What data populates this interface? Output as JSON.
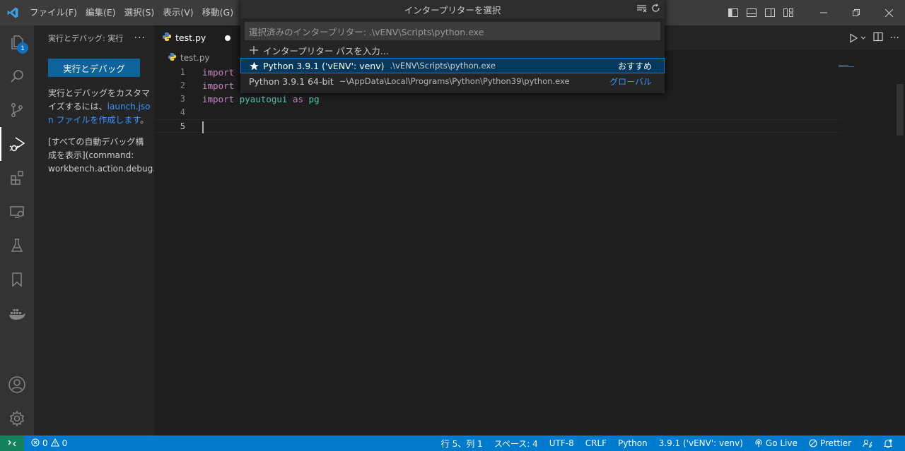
{
  "menu": [
    "ファイル(F)",
    "編集(E)",
    "選択(S)",
    "表示(V)",
    "移動(G)"
  ],
  "activity_badge": "1",
  "sidebar": {
    "header": "実行とデバッグ: 実行",
    "more": "···",
    "run_button": "実行とデバッグ",
    "text_before_link": "実行とデバッグをカスタマイズするには、",
    "link": "launch.json ファイルを作成します",
    "text_after_link": "。",
    "text2_line1": "[すべての自動デバッグ構",
    "text2_line2": "成を表示](command:",
    "text2_line3": "workbench.action.debug.s"
  },
  "editor": {
    "tab_label": "test.py",
    "breadcrumb": "test.py",
    "lines": [
      {
        "num": "1",
        "kw": "import",
        "rest": ""
      },
      {
        "num": "2",
        "kw": "import",
        "rest": ""
      },
      {
        "num": "3",
        "kw": "import",
        "mod": "pyautogui",
        "as": "as",
        "alias": "pg"
      },
      {
        "num": "4"
      },
      {
        "num": "5"
      }
    ]
  },
  "quickpick": {
    "title": "インタープリターを選択",
    "placeholder": "選択済みのインタープリター: .\\vENV\\Scripts\\python.exe",
    "items": [
      {
        "label": "インタープリター パスを入力...",
        "icon": "plus-icon"
      },
      {
        "label": "Python 3.9.1 ('vENV': venv)",
        "desc": ".\\vENV\\Scripts\\python.exe",
        "right": "おすすめ",
        "icon": "star-icon"
      },
      {
        "label": "Python 3.9.1 64-bit",
        "desc": "~\\AppData\\Local\\Programs\\Python\\Python39\\python.exe",
        "right": "グローバル"
      }
    ]
  },
  "status": {
    "errors": "0",
    "warnings": "0",
    "position": "行 5、列 1",
    "spaces": "スペース: 4",
    "encoding": "UTF-8",
    "eol": "CRLF",
    "language": "Python",
    "interpreter": "3.9.1 ('vENV': venv)",
    "golive": "Go Live",
    "prettier": "Prettier"
  },
  "colors": {
    "accent": "#007acc",
    "button": "#0e639c",
    "keyword": "#c586c0",
    "module": "#4ec9b0"
  }
}
